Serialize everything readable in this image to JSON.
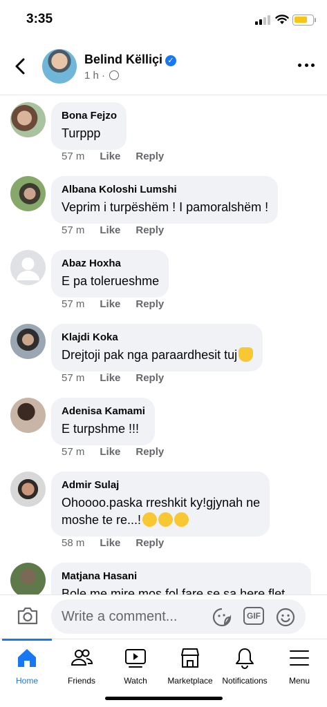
{
  "status_bar": {
    "time": "3:35",
    "battery_color": "#f5c518"
  },
  "header": {
    "author_name": "Belind Këlliçi",
    "verified": true,
    "meta_time": "1 h",
    "meta_sep": "·",
    "privacy_icon": "globe-icon"
  },
  "comments": [
    {
      "author": "Bona Fejzo",
      "text": "Turppp",
      "time": "57 m",
      "like": "Like",
      "reply": "Reply"
    },
    {
      "author": "Albana Koloshi Lumshi",
      "text": "Veprim i turpëshëm ! I pamoralshëm !",
      "time": "57 m",
      "like": "Like",
      "reply": "Reply"
    },
    {
      "author": "Abaz Hoxha",
      "text": "E pa tolerueshme",
      "time": "57 m",
      "like": "Like",
      "reply": "Reply"
    },
    {
      "author": "Klajdi Koka",
      "text": "Drejtoji pak nga paraardhesit tuj",
      "time": "57 m",
      "like": "Like",
      "reply": "Reply"
    },
    {
      "author": "Adenisa Kamami",
      "text": "E turpshme !!!",
      "time": "57 m",
      "like": "Like",
      "reply": "Reply"
    },
    {
      "author": "Admir Sulaj",
      "text_line1": "Ohoooo.paska rreshkit ky!gjynah ne",
      "text_line2": "moshe te re...!",
      "time": "58 m",
      "like": "Like",
      "reply": "Reply"
    },
    {
      "author": "Matjana Hasani",
      "text": "Bole me mire mos fol fare se sa here flet"
    }
  ],
  "composer": {
    "placeholder": "Write a comment...",
    "gif_label": "GIF"
  },
  "nav": {
    "items": [
      {
        "label": "Home",
        "icon": "home-icon"
      },
      {
        "label": "Friends",
        "icon": "friends-icon"
      },
      {
        "label": "Watch",
        "icon": "watch-icon"
      },
      {
        "label": "Marketplace",
        "icon": "marketplace-icon"
      },
      {
        "label": "Notifications",
        "icon": "bell-icon"
      },
      {
        "label": "Menu",
        "icon": "menu-icon"
      }
    ],
    "active_color": "#1877f2"
  }
}
